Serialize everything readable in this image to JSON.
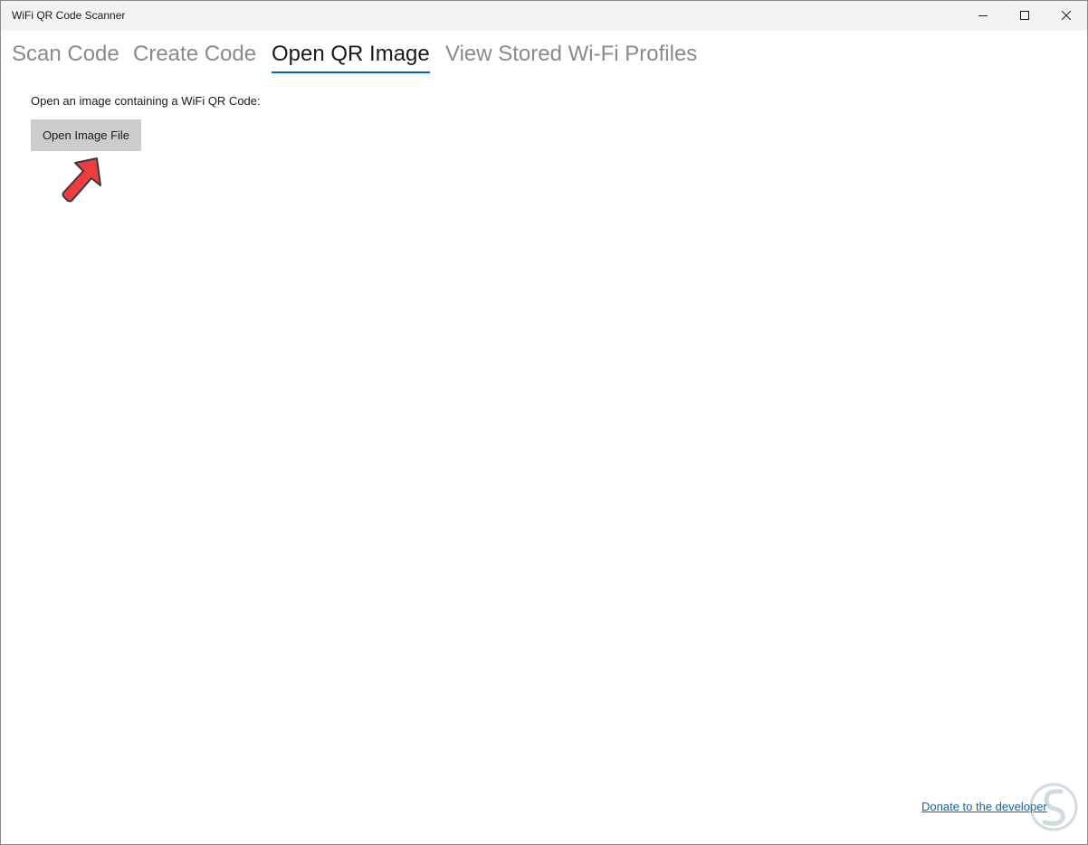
{
  "window": {
    "title": "WiFi QR Code Scanner"
  },
  "caption_buttons": {
    "minimize_icon": "minimize-icon",
    "maximize_icon": "maximize-icon",
    "close_icon": "close-icon"
  },
  "tabs": [
    {
      "label": "Scan Code",
      "active": false
    },
    {
      "label": "Create Code",
      "active": false
    },
    {
      "label": "Open QR Image",
      "active": true
    },
    {
      "label": "View Stored Wi-Fi Profiles",
      "active": false
    }
  ],
  "main": {
    "instruction": "Open an image containing a WiFi QR Code:",
    "open_button_label": "Open Image File"
  },
  "footer": {
    "donate_link": "Donate to the developer"
  },
  "colors": {
    "accent": "#0067c0",
    "arrow_fill": "#ef3c3c",
    "button_bg": "#cccccc",
    "inactive_tab": "#8a8a8a"
  }
}
